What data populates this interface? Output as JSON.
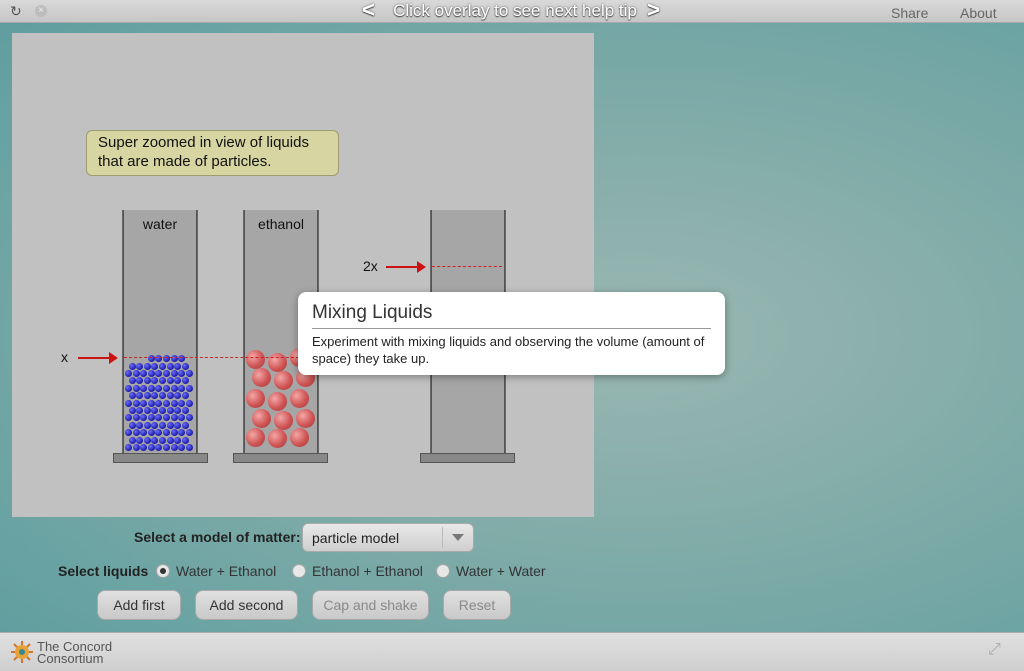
{
  "topbar": {
    "help_text": "Click overlay to see next help tip",
    "prev_arrow": "<",
    "next_arrow": ">",
    "share": "Share",
    "about": "About",
    "reload_icon": "↻",
    "close_icon": "×"
  },
  "sim": {
    "note": "Super zoomed in view of liquids that are made of particles.",
    "beakers": [
      {
        "label": "water"
      },
      {
        "label": "ethanol"
      },
      {
        "label": ""
      }
    ],
    "marker_x": "x",
    "marker_2x": "2x"
  },
  "tooltip": {
    "title": "Mixing Liquids",
    "body": "Experiment with mixing liquids and observing the volume (amount of space) they take up."
  },
  "controls": {
    "model_label": "Select a model of matter:",
    "model_value": "particle model",
    "liquids_label": "Select liquids",
    "options": [
      {
        "label": "Water + Ethanol",
        "selected": true
      },
      {
        "label": "Ethanol + Ethanol",
        "selected": false
      },
      {
        "label": "Water + Water",
        "selected": false
      }
    ],
    "buttons": [
      {
        "label": "Add first",
        "enabled": true
      },
      {
        "label": "Add second",
        "enabled": true
      },
      {
        "label": "Cap and shake",
        "enabled": false
      },
      {
        "label": "Reset",
        "enabled": false
      }
    ]
  },
  "footer": {
    "logo_line1": "The Concord",
    "logo_line2": "Consortium",
    "fullscreen_icon": "⤢"
  },
  "colors": {
    "water_particle": "#1b1ba8",
    "ethanol_particle": "#cf5555",
    "level_line": "#cc1111",
    "note_bg": "#d7d6a2"
  }
}
